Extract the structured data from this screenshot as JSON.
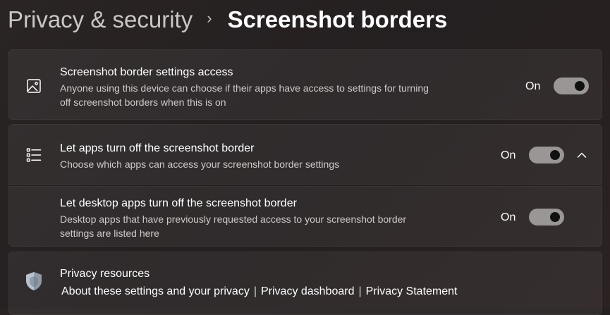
{
  "breadcrumb": {
    "parent": "Privacy & security",
    "separator": "›",
    "current": "Screenshot borders"
  },
  "settings": [
    {
      "title": "Screenshot border settings access",
      "description": "Anyone using this device can choose if their apps have access to settings for turning off screenshot borders when this is on",
      "state_label": "On",
      "toggle_on": true,
      "icon": "image-icon"
    },
    {
      "title": "Let apps turn off the screenshot border",
      "description": "Choose which apps can access your screenshot border settings",
      "state_label": "On",
      "toggle_on": true,
      "icon": "list-icon",
      "expanded": true
    },
    {
      "title": "Let desktop apps turn off the screenshot border",
      "description": "Desktop apps that have previously requested access to your screenshot border settings are listed here",
      "state_label": "On",
      "toggle_on": true
    }
  ],
  "privacy_resources": {
    "title": "Privacy resources",
    "icon": "shield-icon",
    "links": [
      "About these settings and your privacy",
      "Privacy dashboard",
      "Privacy Statement"
    ],
    "link_separator": "|"
  },
  "colors": {
    "background": "#262021",
    "card": "#353030",
    "toggle_track": "#9a9696",
    "toggle_knob": "#111111"
  }
}
